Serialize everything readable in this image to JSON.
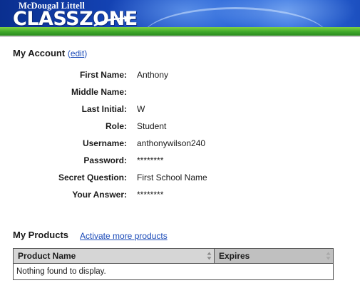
{
  "header": {
    "publisher": "McDougal Littell",
    "logo_text": "CLASSZONE",
    "colors": {
      "banner_blue": "#1545b8",
      "banner_green": "#3fa82a"
    }
  },
  "account": {
    "title": "My Account",
    "edit_link": "edit",
    "fields": [
      {
        "label": "First Name:",
        "value": "Anthony"
      },
      {
        "label": "Middle Name:",
        "value": ""
      },
      {
        "label": "Last Initial:",
        "value": "W"
      },
      {
        "label": "Role:",
        "value": "Student"
      },
      {
        "label": "Username:",
        "value": "anthonywilson240"
      },
      {
        "label": "Password:",
        "value": "********"
      },
      {
        "label": "Secret Question:",
        "value": "First School Name"
      },
      {
        "label": "Your Answer:",
        "value": "********"
      }
    ]
  },
  "products": {
    "title": "My Products",
    "activate_link": "Activate more products",
    "columns": [
      "Product Name",
      "Expires"
    ],
    "empty_message": "Nothing found to display.",
    "sort_icon": "sort-arrows-icon"
  },
  "colors": {
    "link": "#1a4ab8",
    "table_header": "#d6d6d6"
  }
}
